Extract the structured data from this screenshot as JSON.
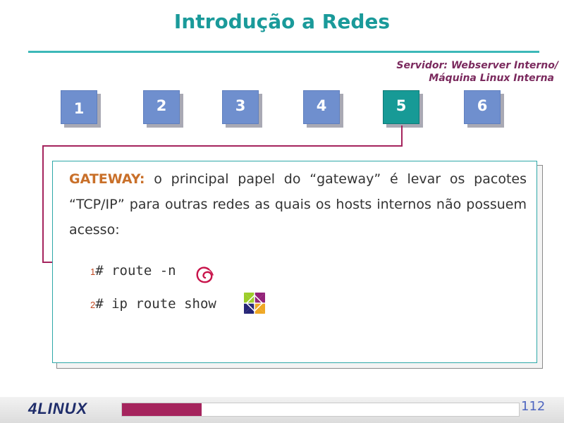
{
  "slide": {
    "title": "Introdução a Redes",
    "subtitle_line1": "Servidor: Webserver Interno/",
    "subtitle_line2": "Máquina Linux Interna"
  },
  "steps": [
    {
      "label": "1",
      "active": false
    },
    {
      "label": "2",
      "active": false
    },
    {
      "label": "3",
      "active": false
    },
    {
      "label": "4",
      "active": false
    },
    {
      "label": "5",
      "active": true
    },
    {
      "label": "6",
      "active": false
    }
  ],
  "content": {
    "keyword": "GATEWAY:",
    "text": " o principal papel do “gateway” é levar os pacotes “TCP/IP” para outras redes as quais os hosts internos não possuem acesso:",
    "commands": [
      {
        "num": "1",
        "text": "# route -n",
        "icon": "debian-swirl-icon"
      },
      {
        "num": "2",
        "text": "# ip route show",
        "icon": "centos-pinwheel-icon"
      }
    ]
  },
  "footer": {
    "logo": "4LINUX",
    "page_number": "112",
    "progress_fraction": 0.2
  },
  "colors": {
    "title": "#1a9a9a",
    "accent": "#a5245d",
    "step_inactive": "#6f8fce",
    "step_active": "#179a96"
  }
}
